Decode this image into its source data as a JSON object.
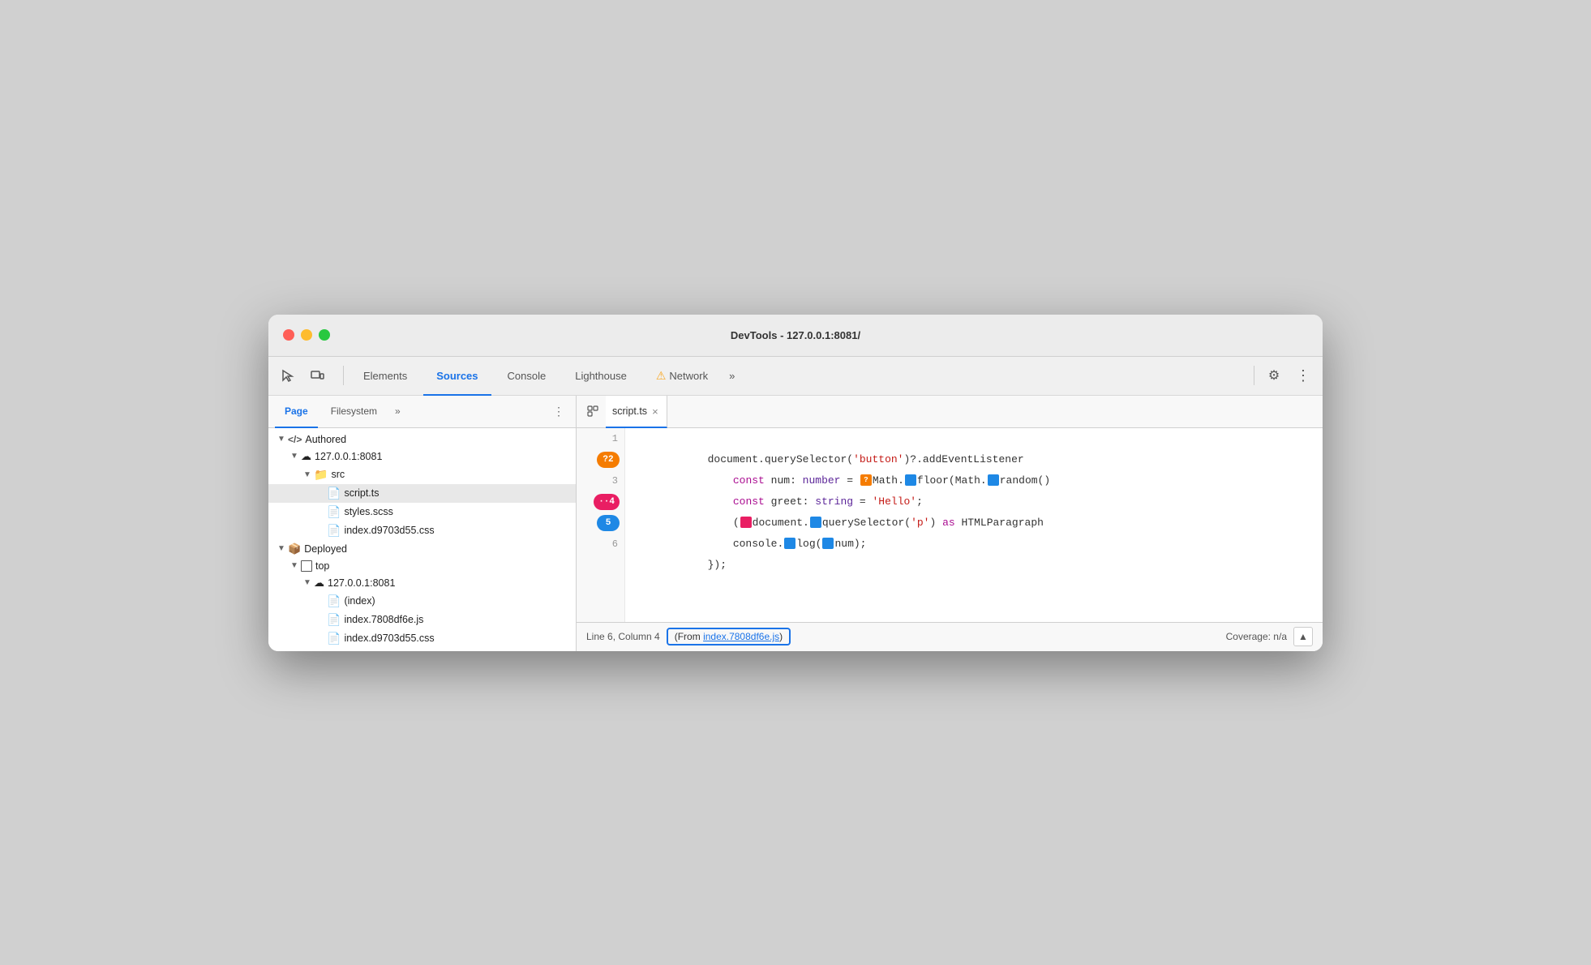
{
  "window": {
    "title": "DevTools - 127.0.0.1:8081/"
  },
  "titlebar_buttons": {
    "close": "●",
    "minimize": "●",
    "maximize": "●"
  },
  "toolbar": {
    "inspect_label": "⬆",
    "device_label": "⬜",
    "tabs": [
      {
        "id": "elements",
        "label": "Elements",
        "active": false
      },
      {
        "id": "sources",
        "label": "Sources",
        "active": true
      },
      {
        "id": "console",
        "label": "Console",
        "active": false
      },
      {
        "id": "lighthouse",
        "label": "Lighthouse",
        "active": false
      },
      {
        "id": "network",
        "label": "Network",
        "active": false,
        "warning": true
      }
    ],
    "more_tabs": "»",
    "settings_icon": "⚙",
    "more_icon": "⋮"
  },
  "left_panel": {
    "sub_tabs": [
      {
        "id": "page",
        "label": "Page",
        "active": true
      },
      {
        "id": "filesystem",
        "label": "Filesystem",
        "active": false
      }
    ],
    "more": "»",
    "dots": "⋮",
    "tree": [
      {
        "id": "authored",
        "label": "Authored",
        "depth": 0,
        "icon": "</>",
        "expanded": true,
        "arrow": "▼",
        "icon_type": "code"
      },
      {
        "id": "host1",
        "label": "127.0.0.1:8081",
        "depth": 1,
        "expanded": true,
        "arrow": "▼",
        "icon_type": "cloud"
      },
      {
        "id": "src",
        "label": "src",
        "depth": 2,
        "expanded": true,
        "arrow": "▼",
        "icon_type": "folder_orange"
      },
      {
        "id": "script_ts",
        "label": "script.ts",
        "depth": 3,
        "selected": true,
        "icon_type": "file_yellow"
      },
      {
        "id": "styles_scss",
        "label": "styles.scss",
        "depth": 3,
        "icon_type": "file_gray"
      },
      {
        "id": "index_css1",
        "label": "index.d9703d55.css",
        "depth": 3,
        "icon_type": "file_purple"
      },
      {
        "id": "deployed",
        "label": "Deployed",
        "depth": 0,
        "expanded": true,
        "arrow": "▼",
        "icon_type": "cube"
      },
      {
        "id": "top",
        "label": "top",
        "depth": 1,
        "expanded": true,
        "arrow": "▼",
        "icon_type": "square"
      },
      {
        "id": "host2",
        "label": "127.0.0.1:8081",
        "depth": 2,
        "expanded": true,
        "arrow": "▼",
        "icon_type": "cloud"
      },
      {
        "id": "index_html",
        "label": "(index)",
        "depth": 3,
        "icon_type": "file_gray"
      },
      {
        "id": "index_js",
        "label": "index.7808df6e.js",
        "depth": 3,
        "icon_type": "file_yellow"
      },
      {
        "id": "index_css2",
        "label": "index.d9703d55.css",
        "depth": 3,
        "icon_type": "file_purple"
      }
    ]
  },
  "editor": {
    "file_tab": "script.ts",
    "close_btn": "×",
    "lines": [
      {
        "num": 1,
        "badge": null,
        "code": "document.querySelector('button')?.addEventListener"
      },
      {
        "num": 2,
        "badge": "?2",
        "badge_type": "orange",
        "code": "    const num: number = ❓Math.⬜floor(Math.⬜random()"
      },
      {
        "num": 3,
        "badge": null,
        "code": "    const greet: string = 'Hello';"
      },
      {
        "num": 4,
        "badge": "··4",
        "badge_type": "pink",
        "code": "    (⬜document.⬜querySelector('p') as HTMLParagraph"
      },
      {
        "num": 5,
        "badge": "5",
        "badge_type": "blue",
        "code": "    console.⬜log(⬜num);"
      },
      {
        "num": 6,
        "badge": null,
        "code": "});"
      }
    ]
  },
  "status_bar": {
    "position": "Line 6, Column 4",
    "from_label": "(From index.7808df6e.js)",
    "from_link": "index.7808df6e.js",
    "coverage": "Coverage: n/a",
    "icon_btn": "▲"
  }
}
